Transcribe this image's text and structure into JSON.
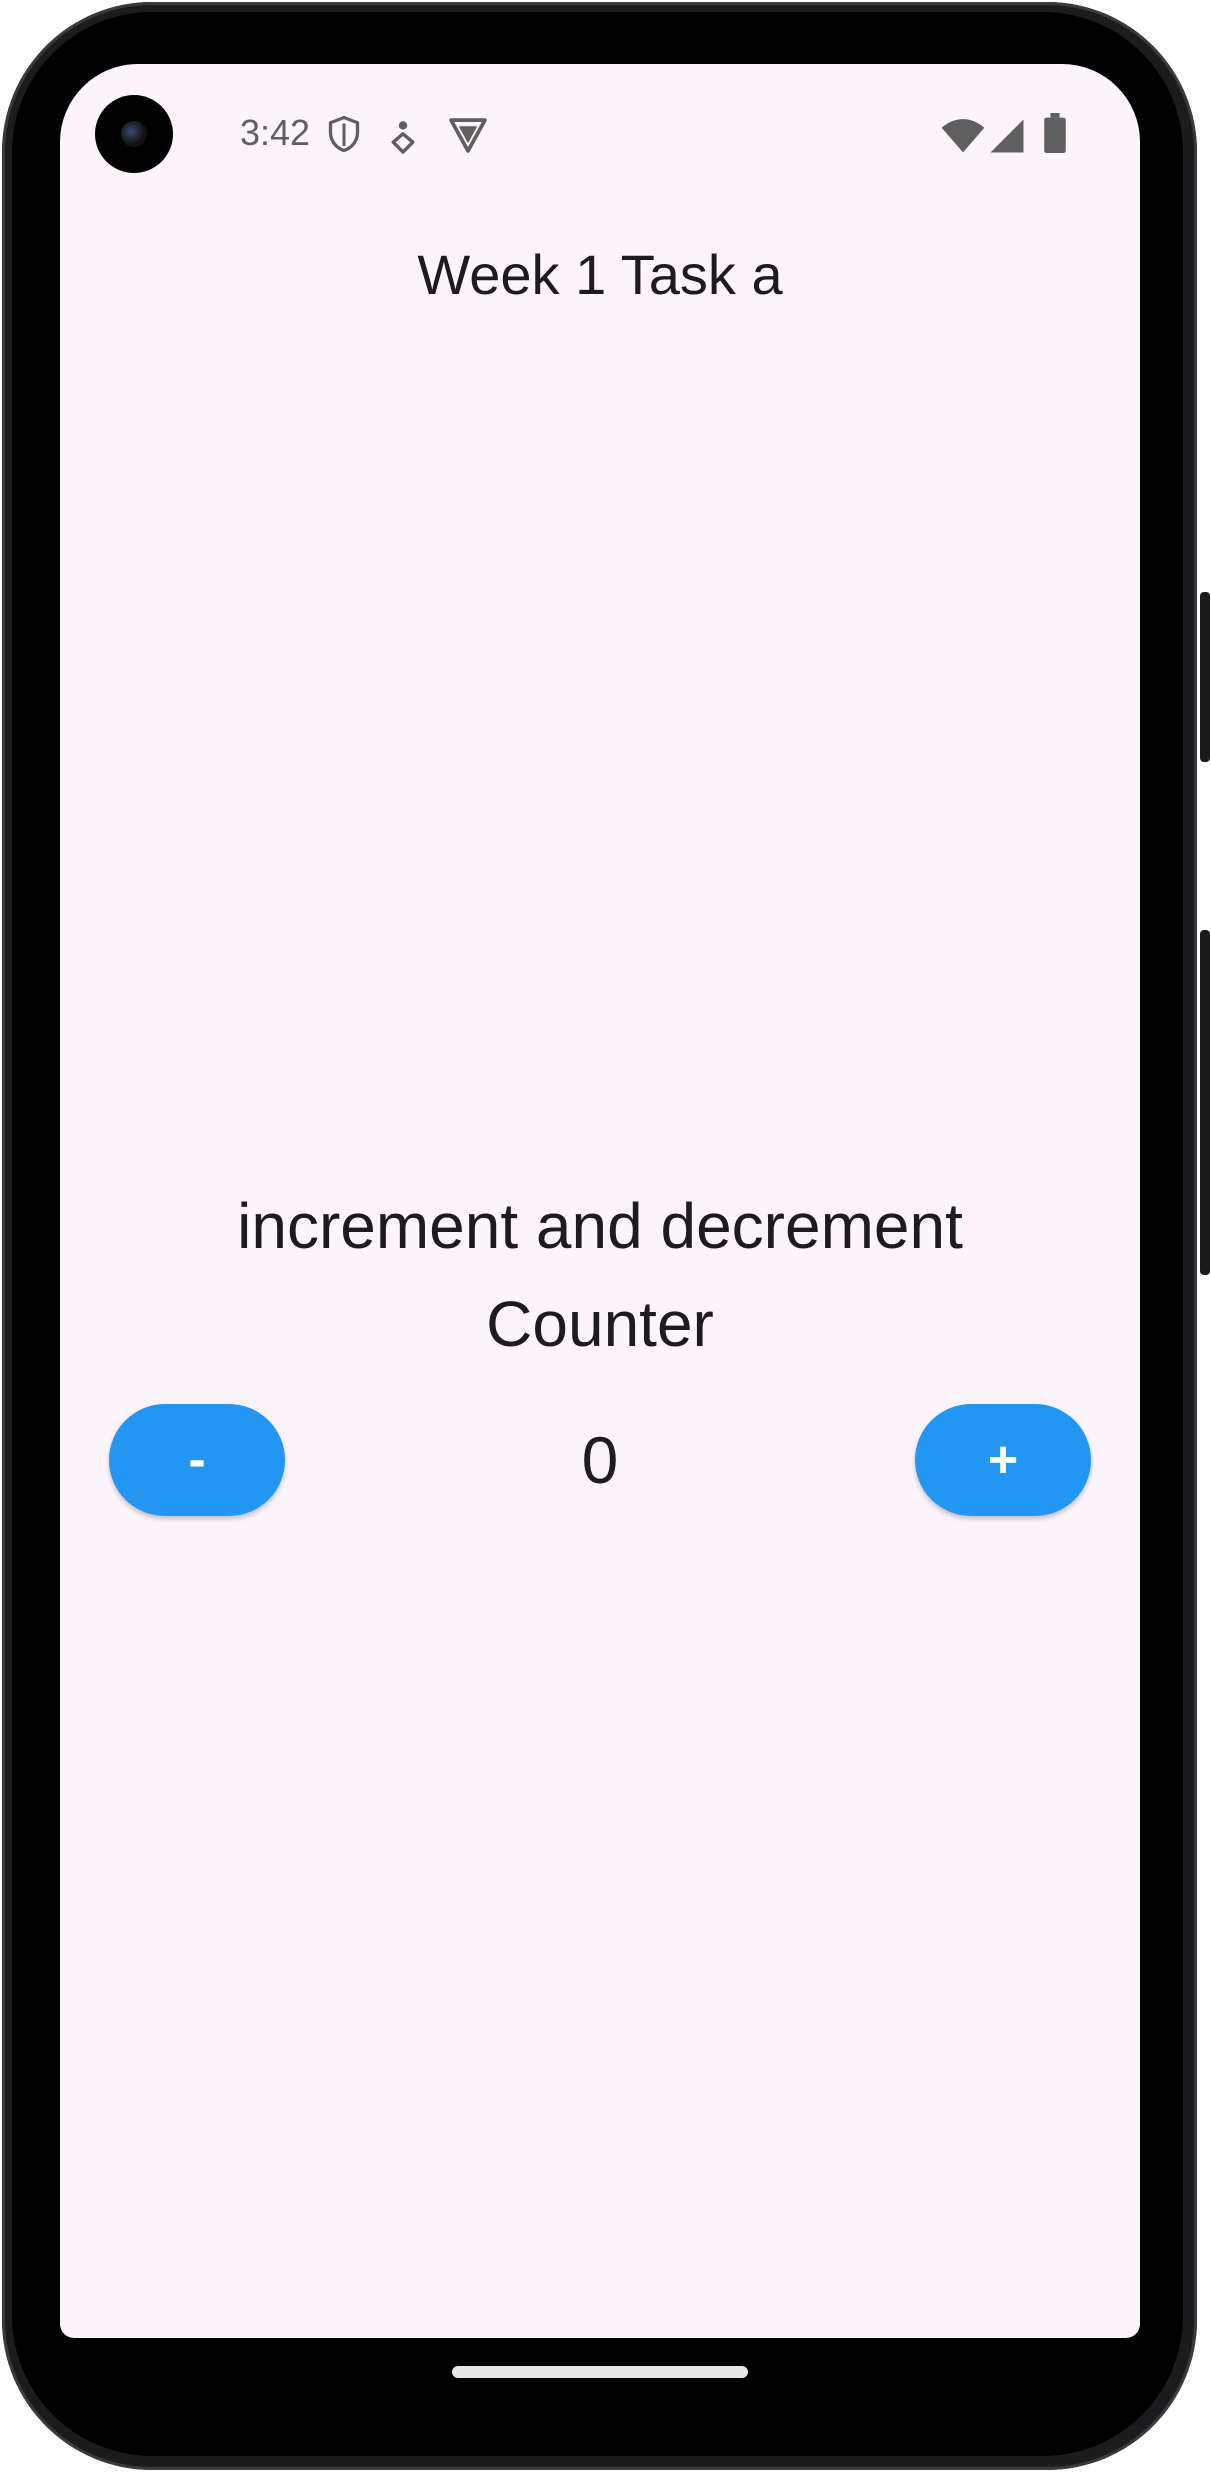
{
  "status_bar": {
    "time": "3:42",
    "icon_color": "#5f5f5f",
    "left_icons": [
      "shield-icon",
      "accessibility-icon",
      "vpn-icon"
    ],
    "right_icons": [
      "wifi-icon",
      "cell-signal-icon",
      "battery-icon"
    ]
  },
  "app": {
    "title": "Week 1 Task a",
    "background": "#fcf4fb",
    "text_color": "#1d1b20"
  },
  "counter": {
    "label_line1": "increment and decrement",
    "label_line2": "Counter",
    "value": "0",
    "decrement_label": "-",
    "increment_label": "+",
    "button_color": "#2196f3"
  }
}
